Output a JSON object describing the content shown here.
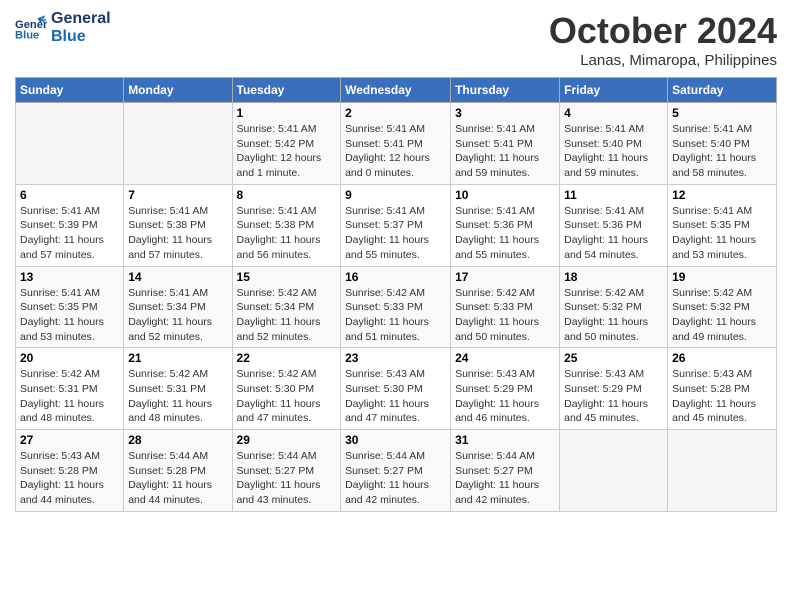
{
  "header": {
    "logo_line1": "General",
    "logo_line2": "Blue",
    "month_title": "October 2024",
    "location": "Lanas, Mimaropa, Philippines"
  },
  "columns": [
    "Sunday",
    "Monday",
    "Tuesday",
    "Wednesday",
    "Thursday",
    "Friday",
    "Saturday"
  ],
  "weeks": [
    [
      {
        "day": "",
        "info": ""
      },
      {
        "day": "",
        "info": ""
      },
      {
        "day": "1",
        "info": "Sunrise: 5:41 AM\nSunset: 5:42 PM\nDaylight: 12 hours\nand 1 minute."
      },
      {
        "day": "2",
        "info": "Sunrise: 5:41 AM\nSunset: 5:41 PM\nDaylight: 12 hours\nand 0 minutes."
      },
      {
        "day": "3",
        "info": "Sunrise: 5:41 AM\nSunset: 5:41 PM\nDaylight: 11 hours\nand 59 minutes."
      },
      {
        "day": "4",
        "info": "Sunrise: 5:41 AM\nSunset: 5:40 PM\nDaylight: 11 hours\nand 59 minutes."
      },
      {
        "day": "5",
        "info": "Sunrise: 5:41 AM\nSunset: 5:40 PM\nDaylight: 11 hours\nand 58 minutes."
      }
    ],
    [
      {
        "day": "6",
        "info": "Sunrise: 5:41 AM\nSunset: 5:39 PM\nDaylight: 11 hours\nand 57 minutes."
      },
      {
        "day": "7",
        "info": "Sunrise: 5:41 AM\nSunset: 5:38 PM\nDaylight: 11 hours\nand 57 minutes."
      },
      {
        "day": "8",
        "info": "Sunrise: 5:41 AM\nSunset: 5:38 PM\nDaylight: 11 hours\nand 56 minutes."
      },
      {
        "day": "9",
        "info": "Sunrise: 5:41 AM\nSunset: 5:37 PM\nDaylight: 11 hours\nand 55 minutes."
      },
      {
        "day": "10",
        "info": "Sunrise: 5:41 AM\nSunset: 5:36 PM\nDaylight: 11 hours\nand 55 minutes."
      },
      {
        "day": "11",
        "info": "Sunrise: 5:41 AM\nSunset: 5:36 PM\nDaylight: 11 hours\nand 54 minutes."
      },
      {
        "day": "12",
        "info": "Sunrise: 5:41 AM\nSunset: 5:35 PM\nDaylight: 11 hours\nand 53 minutes."
      }
    ],
    [
      {
        "day": "13",
        "info": "Sunrise: 5:41 AM\nSunset: 5:35 PM\nDaylight: 11 hours\nand 53 minutes."
      },
      {
        "day": "14",
        "info": "Sunrise: 5:41 AM\nSunset: 5:34 PM\nDaylight: 11 hours\nand 52 minutes."
      },
      {
        "day": "15",
        "info": "Sunrise: 5:42 AM\nSunset: 5:34 PM\nDaylight: 11 hours\nand 52 minutes."
      },
      {
        "day": "16",
        "info": "Sunrise: 5:42 AM\nSunset: 5:33 PM\nDaylight: 11 hours\nand 51 minutes."
      },
      {
        "day": "17",
        "info": "Sunrise: 5:42 AM\nSunset: 5:33 PM\nDaylight: 11 hours\nand 50 minutes."
      },
      {
        "day": "18",
        "info": "Sunrise: 5:42 AM\nSunset: 5:32 PM\nDaylight: 11 hours\nand 50 minutes."
      },
      {
        "day": "19",
        "info": "Sunrise: 5:42 AM\nSunset: 5:32 PM\nDaylight: 11 hours\nand 49 minutes."
      }
    ],
    [
      {
        "day": "20",
        "info": "Sunrise: 5:42 AM\nSunset: 5:31 PM\nDaylight: 11 hours\nand 48 minutes."
      },
      {
        "day": "21",
        "info": "Sunrise: 5:42 AM\nSunset: 5:31 PM\nDaylight: 11 hours\nand 48 minutes."
      },
      {
        "day": "22",
        "info": "Sunrise: 5:42 AM\nSunset: 5:30 PM\nDaylight: 11 hours\nand 47 minutes."
      },
      {
        "day": "23",
        "info": "Sunrise: 5:43 AM\nSunset: 5:30 PM\nDaylight: 11 hours\nand 47 minutes."
      },
      {
        "day": "24",
        "info": "Sunrise: 5:43 AM\nSunset: 5:29 PM\nDaylight: 11 hours\nand 46 minutes."
      },
      {
        "day": "25",
        "info": "Sunrise: 5:43 AM\nSunset: 5:29 PM\nDaylight: 11 hours\nand 45 minutes."
      },
      {
        "day": "26",
        "info": "Sunrise: 5:43 AM\nSunset: 5:28 PM\nDaylight: 11 hours\nand 45 minutes."
      }
    ],
    [
      {
        "day": "27",
        "info": "Sunrise: 5:43 AM\nSunset: 5:28 PM\nDaylight: 11 hours\nand 44 minutes."
      },
      {
        "day": "28",
        "info": "Sunrise: 5:44 AM\nSunset: 5:28 PM\nDaylight: 11 hours\nand 44 minutes."
      },
      {
        "day": "29",
        "info": "Sunrise: 5:44 AM\nSunset: 5:27 PM\nDaylight: 11 hours\nand 43 minutes."
      },
      {
        "day": "30",
        "info": "Sunrise: 5:44 AM\nSunset: 5:27 PM\nDaylight: 11 hours\nand 42 minutes."
      },
      {
        "day": "31",
        "info": "Sunrise: 5:44 AM\nSunset: 5:27 PM\nDaylight: 11 hours\nand 42 minutes."
      },
      {
        "day": "",
        "info": ""
      },
      {
        "day": "",
        "info": ""
      }
    ]
  ]
}
